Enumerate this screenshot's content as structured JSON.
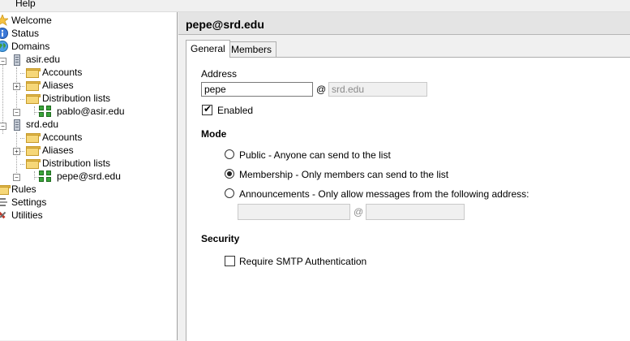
{
  "menu": {
    "help": "Help"
  },
  "tree": {
    "welcome": "Welcome",
    "status": "Status",
    "domains": "Domains",
    "domain1": {
      "name": "asir.edu",
      "accounts": "Accounts",
      "aliases": "Aliases",
      "distribution_lists": "Distribution lists",
      "list_item": "pablo@asir.edu"
    },
    "domain2": {
      "name": "srd.edu",
      "accounts": "Accounts",
      "aliases": "Aliases",
      "distribution_lists": "Distribution lists",
      "list_item": "pepe@srd.edu"
    },
    "rules": "Rules",
    "settings": "Settings",
    "utilities": "Utilities"
  },
  "header": {
    "title": "pepe@srd.edu"
  },
  "tabs": [
    "General",
    "Members"
  ],
  "general": {
    "address_label": "Address",
    "address_value": "pepe",
    "at_symbol": "@",
    "domain_value": "srd.edu",
    "enabled_label": "Enabled",
    "enabled_checked": true,
    "mode_heading": "Mode",
    "mode_options": [
      "Public - Anyone can send to the list",
      "Membership - Only members can send to the list",
      "Announcements - Only allow messages from the following address:"
    ],
    "mode_selected": 1,
    "announce_user_value": "",
    "announce_domain_value": "",
    "security_heading": "Security",
    "smtp_auth_label": "Require SMTP Authentication",
    "smtp_auth_checked": false
  }
}
